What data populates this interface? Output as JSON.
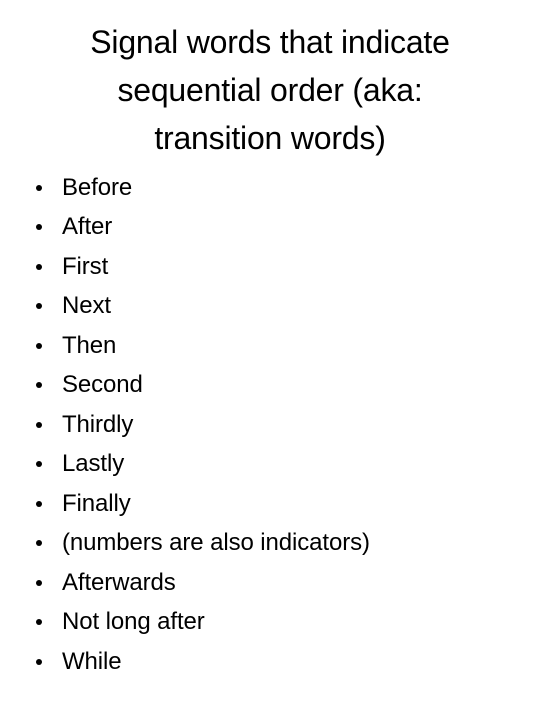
{
  "slide": {
    "background_color": "#ffffff",
    "text_color": "#000000",
    "title": {
      "full_text": "Signal words that indicate sequential order (aka: transition words)",
      "lines": [
        "Signal words that indicate",
        "sequential order (aka:",
        "transition words)"
      ]
    },
    "bullets": {
      "marker": "bullet-dot",
      "items": [
        "Before",
        "After",
        "First",
        "Next",
        "Then",
        "Second",
        "Thirdly",
        "Lastly",
        "Finally",
        "(numbers are also indicators)",
        "Afterwards",
        "Not long after",
        "While"
      ]
    }
  }
}
